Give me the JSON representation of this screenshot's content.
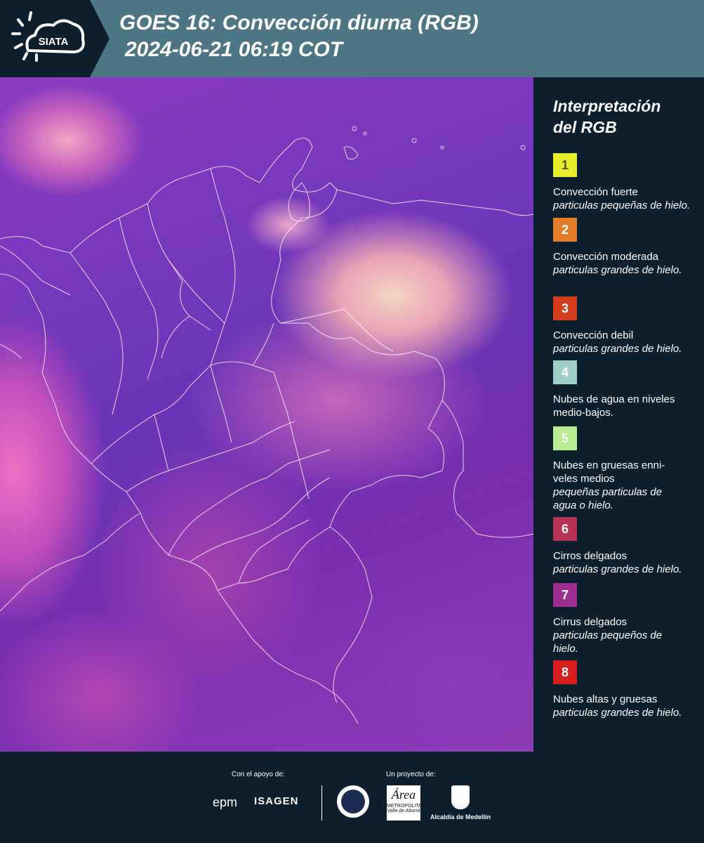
{
  "header": {
    "logo_text": "SIATA",
    "title_line1": "GOES 16: Convección diurna (RGB)",
    "title_line2": "2024-06-21 06:19 COT"
  },
  "legend": {
    "title_line1": "Interpretación",
    "title_line2": "del RGB",
    "items": [
      {
        "number": "1",
        "color": "#e6ef2c",
        "number_color": "#5b4f1a",
        "label": "Convección fuerte",
        "description": "particulas pequeñas de hielo."
      },
      {
        "number": "2",
        "color": "#e27d2a",
        "number_color": "#ffffff",
        "label": "Convección moderada",
        "description": "particulas grandes de hielo."
      },
      {
        "number": "3",
        "color": "#d43e1e",
        "number_color": "#ffffff",
        "label": "Convección debil",
        "description": "particulas grandes de hielo."
      },
      {
        "number": "4",
        "color": "#9ecfc8",
        "number_color": "#ffffff",
        "label": "Nubes de agua en niveles medio-bajos.",
        "description": ""
      },
      {
        "number": "5",
        "color": "#b6ec8f",
        "number_color": "#ffffff",
        "label": "Nubes en gruesas enni-veles medios",
        "description": "pequeñas particulas de agua o hielo."
      },
      {
        "number": "6",
        "color": "#b83254",
        "number_color": "#ffffff",
        "label": "Cirros delgados",
        "description": "particulas grandes de hielo."
      },
      {
        "number": "7",
        "color": "#9d2d91",
        "number_color": "#ffffff",
        "label": "Cirrus delgados",
        "description": "particulas pequeños de hielo."
      },
      {
        "number": "8",
        "color": "#d81f1f",
        "number_color": "#ffffff",
        "label": "Nubes altas y gruesas",
        "description": "particulas grandes de hielo."
      }
    ]
  },
  "footer": {
    "support_label": "Con el apoyo de:",
    "project_label": "Un proyecto de:",
    "sponsor_1": "epm",
    "sponsor_2": "ISAGEN",
    "partner_amva_mark": "Área",
    "partner_amva_text": "METROPOLITANA Valle de Aburrá",
    "partner_alcaldia": "Alcaldía de Medellín"
  }
}
